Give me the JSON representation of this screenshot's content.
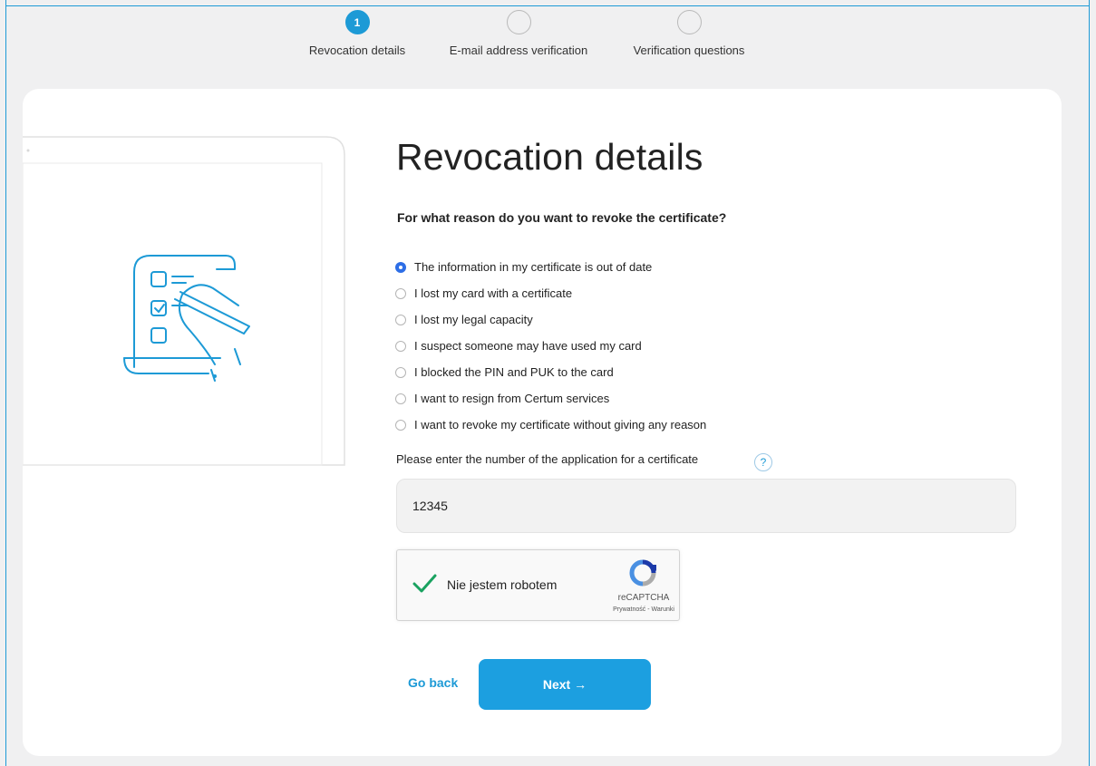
{
  "steps": [
    {
      "number": "1",
      "label": "Revocation details",
      "active": true
    },
    {
      "number": "",
      "label": "E-mail address verification",
      "active": false
    },
    {
      "number": "",
      "label": "Verification questions",
      "active": false
    }
  ],
  "form": {
    "title": "Revocation details",
    "question": "For what reason do you want to revoke the certificate?",
    "reasons": [
      {
        "label": "The information in my certificate is out of date",
        "checked": true
      },
      {
        "label": "I lost my card with a certificate",
        "checked": false
      },
      {
        "label": "I lost my legal capacity",
        "checked": false
      },
      {
        "label": "I suspect someone may have used my card",
        "checked": false
      },
      {
        "label": "I blocked the PIN and PUK to the card",
        "checked": false
      },
      {
        "label": "I want to resign from Certum services",
        "checked": false
      },
      {
        "label": "I want to revoke my certificate without giving any reason",
        "checked": false
      }
    ],
    "application_number_label": "Please enter the number of the application for a certificate",
    "help_symbol": "?",
    "application_number_value": "12345"
  },
  "captcha": {
    "label": "Nie jestem robotem",
    "brand": "reCAPTCHA",
    "terms": "Prywatność - Warunki",
    "checked": true
  },
  "actions": {
    "back_label": "Go back",
    "next_label": "Next →"
  },
  "colors": {
    "accent": "#1d9ad6",
    "radio_checked": "#2d6ee6",
    "captcha_check": "#1aa260"
  }
}
